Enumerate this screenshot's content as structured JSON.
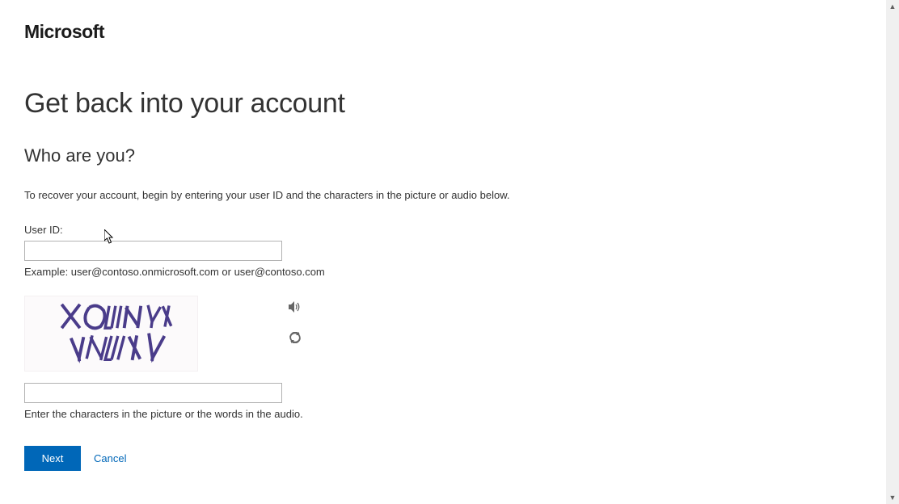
{
  "brand": {
    "name": "Microsoft"
  },
  "page": {
    "title": "Get back into your account",
    "subtitle": "Who are you?",
    "instructions": "To recover your account, begin by entering your user ID and the characters in the picture or audio below."
  },
  "form": {
    "user_id_label": "User ID:",
    "user_id_value": "",
    "user_id_example": "Example: user@contoso.onmicrosoft.com or user@contoso.com",
    "captcha_text": "X6WNYVXY",
    "captcha_value": "",
    "captcha_hint": "Enter the characters in the picture or the words in the audio."
  },
  "buttons": {
    "next": "Next",
    "cancel": "Cancel"
  },
  "icons": {
    "audio": "speaker-icon",
    "refresh": "refresh-icon"
  },
  "colors": {
    "primary": "#0067b8",
    "text": "#333333",
    "border": "#b2b2b2"
  }
}
